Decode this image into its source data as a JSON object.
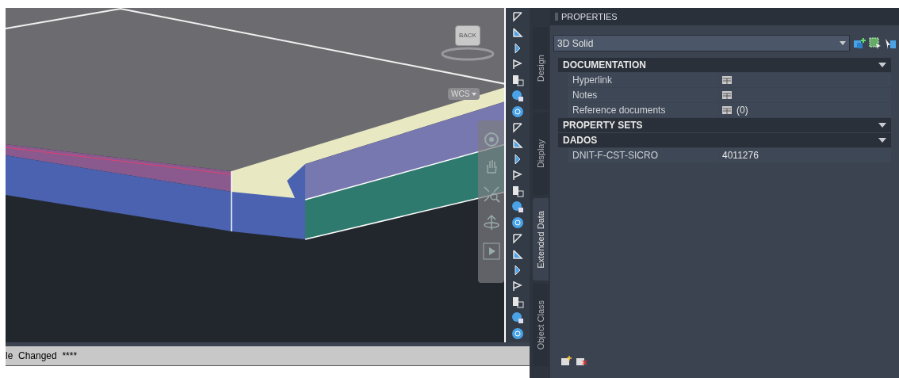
{
  "viewport": {
    "viewcube_label": "BACK",
    "ucs_label": "WCS"
  },
  "command_line": {
    "text": "le  Changed  ****"
  },
  "side_tabs": [
    {
      "label": "Design",
      "selected": false
    },
    {
      "label": "Display",
      "selected": false
    },
    {
      "label": "Extended Data",
      "selected": true
    },
    {
      "label": "Object Class",
      "selected": false
    }
  ],
  "properties": {
    "title": "PROPERTIES",
    "object_type": "3D Solid",
    "sections": [
      {
        "title": "DOCUMENTATION",
        "rows": [
          {
            "name": "Hyperlink",
            "kind": "table"
          },
          {
            "name": "Notes",
            "kind": "table"
          },
          {
            "name": "Reference documents",
            "kind": "table",
            "value": "(0)"
          }
        ]
      },
      {
        "title": "PROPERTY SETS"
      },
      {
        "title": "DADOS",
        "rows": [
          {
            "name": "DNIT-F-CST-SICRO",
            "kind": "text",
            "value": "4011276"
          }
        ]
      }
    ]
  }
}
